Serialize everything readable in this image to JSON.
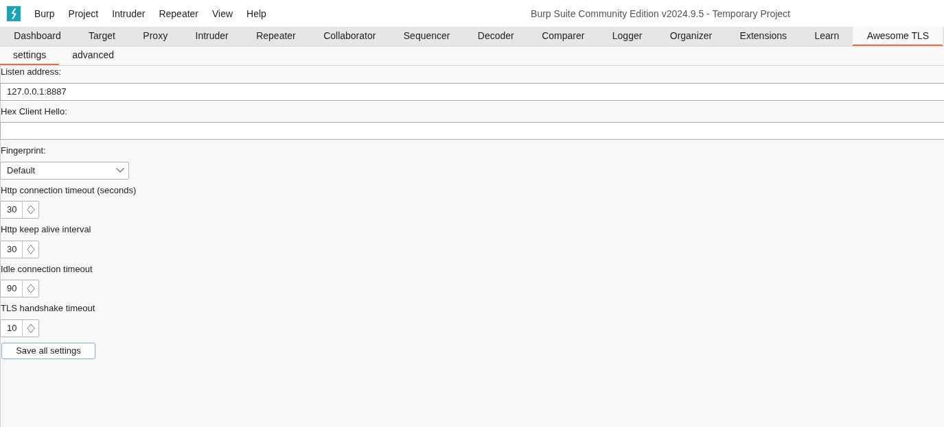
{
  "title_bar": {
    "menu": [
      "Burp",
      "Project",
      "Intruder",
      "Repeater",
      "View",
      "Help"
    ],
    "title": "Burp Suite Community Edition v2024.9.5 - Temporary Project"
  },
  "tabs": [
    {
      "label": "Dashboard",
      "selected": false
    },
    {
      "label": "Target",
      "selected": false
    },
    {
      "label": "Proxy",
      "selected": false
    },
    {
      "label": "Intruder",
      "selected": false
    },
    {
      "label": "Repeater",
      "selected": false
    },
    {
      "label": "Collaborator",
      "selected": false
    },
    {
      "label": "Sequencer",
      "selected": false
    },
    {
      "label": "Decoder",
      "selected": false
    },
    {
      "label": "Comparer",
      "selected": false
    },
    {
      "label": "Logger",
      "selected": false
    },
    {
      "label": "Organizer",
      "selected": false
    },
    {
      "label": "Extensions",
      "selected": false
    },
    {
      "label": "Learn",
      "selected": false
    },
    {
      "label": "Awesome TLS",
      "selected": true
    }
  ],
  "sub_tabs": [
    {
      "label": "settings",
      "selected": true
    },
    {
      "label": "advanced",
      "selected": false
    }
  ],
  "form": {
    "fields": [
      {
        "kind": "text",
        "label": "Listen address:",
        "value": "127.0.0.1:8887"
      },
      {
        "kind": "text",
        "label": "Hex Client Hello:"
      },
      {
        "kind": "select",
        "label": "Fingerprint:",
        "value": "Default"
      },
      {
        "kind": "number",
        "label": "Http connection timeout (seconds)",
        "value": "30"
      },
      {
        "kind": "number",
        "label": "Http keep alive interval",
        "value": "30"
      },
      {
        "kind": "number",
        "label": "Idle connection timeout",
        "value": "90"
      },
      {
        "kind": "number",
        "label": "TLS handshake timeout",
        "value": "10"
      }
    ],
    "save_button": "Save all settings"
  }
}
